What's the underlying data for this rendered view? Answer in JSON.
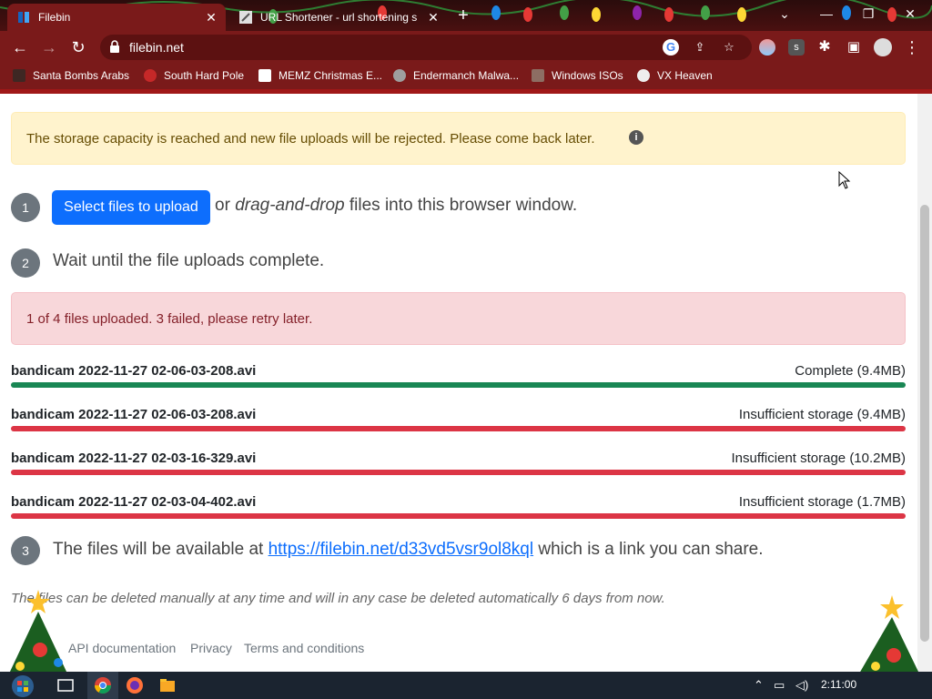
{
  "browser": {
    "tabs": [
      {
        "title": "Filebin",
        "active": true
      },
      {
        "title": "URL Shortener - url shortening s",
        "active": false
      }
    ],
    "url": "filebin.net",
    "bookmarks": [
      "Santa Bombs Arabs",
      "South Hard Pole",
      "MEMZ Christmas E...",
      "Endermanch Malwa...",
      "Windows ISOs",
      "VX Heaven"
    ]
  },
  "page": {
    "storage_alert": "The storage capacity is reached and new file uploads will be rejected. Please come back later.",
    "step1": {
      "number": "1",
      "button": "Select files to upload",
      "or": "or",
      "dnd": "drag-and-drop",
      "rest": "files into this browser window."
    },
    "step2": {
      "number": "2",
      "text": "Wait until the file uploads complete."
    },
    "upload_alert": "1 of 4 files uploaded. 3 failed, please retry later.",
    "files": [
      {
        "name": "bandicam 2022-11-27 02-06-03-208.avi",
        "status": "Complete (9.4MB)",
        "state": "success"
      },
      {
        "name": "bandicam 2022-11-27 02-06-03-208.avi",
        "status": "Insufficient storage (9.4MB)",
        "state": "failed"
      },
      {
        "name": "bandicam 2022-11-27 02-03-16-329.avi",
        "status": "Insufficient storage (10.2MB)",
        "state": "failed"
      },
      {
        "name": "bandicam 2022-11-27 02-03-04-402.avi",
        "status": "Insufficient storage (1.7MB)",
        "state": "failed"
      }
    ],
    "step3": {
      "number": "3",
      "prefix": "The files will be available at",
      "link": "https://filebin.net/d33vd5vsr9ol8kql",
      "suffix": "which is a link you can share."
    },
    "note": "The files can be deleted manually at any time and will in any case be deleted automatically 6 days from now.",
    "footer": {
      "api": "API documentation",
      "privacy": "Privacy",
      "terms": "Terms and conditions"
    }
  },
  "taskbar": {
    "time": "2:11:00"
  },
  "colors": {
    "success": "#198754",
    "danger": "#dc3545",
    "primary": "#0d6efd",
    "chrome": "#7a1a1a"
  }
}
